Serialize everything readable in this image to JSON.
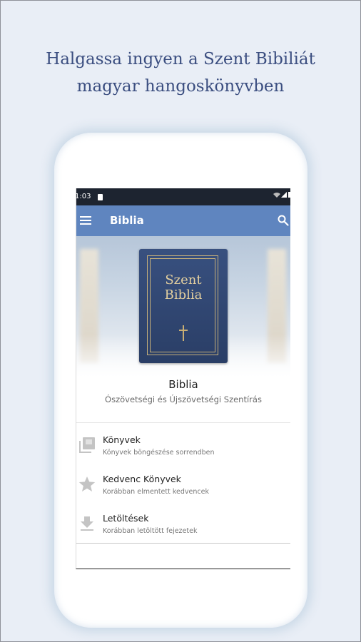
{
  "promo": {
    "line1": "Halgassa ingyen a Szent Bibiliát",
    "line2": "magyar hangoskönyvben"
  },
  "status_bar": {
    "time": "1:03"
  },
  "app_bar": {
    "title": "Biblia"
  },
  "cover": {
    "line1": "Szent",
    "line2": "Biblia"
  },
  "book": {
    "title": "Biblia",
    "subtitle": "Ószövetségi és Újszövetségi Szentírás"
  },
  "menu": [
    {
      "label": "Könyvek",
      "sub": "Könyvek böngészése sorrendben",
      "icon": "library-books-icon"
    },
    {
      "label": "Kedvenc Könyvek",
      "sub": "Korábban elmentett kedvencek",
      "icon": "star-icon"
    },
    {
      "label": "Letöltések",
      "sub": "Korábban letöltött fejezetek",
      "icon": "download-icon"
    }
  ],
  "colors": {
    "app_bar": "#5f85bf",
    "background": "#e9eef6",
    "cover": "#2f4674",
    "cover_text": "#e3cf9f",
    "promo_text": "#3b4e80"
  }
}
